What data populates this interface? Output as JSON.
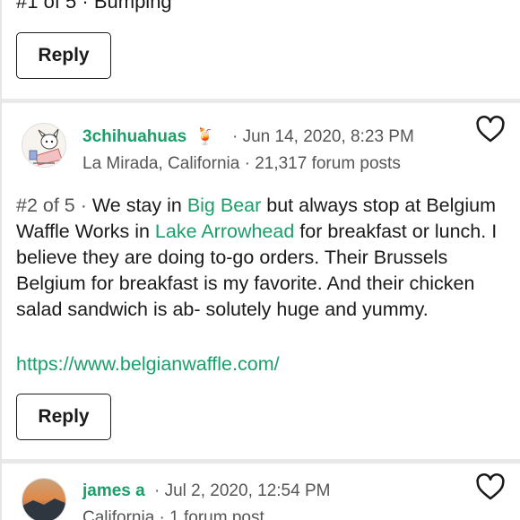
{
  "post1": {
    "tail_text": "#1 of 5 · Bumping",
    "reply_label": "Reply"
  },
  "post2": {
    "username": "3chihuahuas",
    "badge_emoji": "🍹",
    "date": "· Jun 14, 2020, 8:23 PM",
    "location": "La Mirada, California · 21,317 forum posts",
    "post_number": "#2 of 5 ·",
    "body_parts": {
      "t1": " We stay in ",
      "link1": "Big Bear",
      "t2": " but always stop at Belgium Waffle Works in ",
      "link2": "Lake Arrowhead",
      "t3": " for breakfast or lunch. I believe they are doing to-go orders. Their Brussels Belgium for breakfast is my favorite. And their chicken salad sandwich is ab- solutely huge and yummy."
    },
    "url": "https://www.belgianwaffle.com/",
    "reply_label": "Reply"
  },
  "post3": {
    "username": "james a",
    "date": "· Jul 2, 2020, 12:54 PM",
    "location": "California · 1 forum post"
  },
  "colors": {
    "accent": "#1a9e6a",
    "text": "#1a1a1a",
    "muted": "#555555",
    "divider": "#e9e9e9"
  },
  "icons": {
    "favorite": "heart-outline-icon"
  }
}
